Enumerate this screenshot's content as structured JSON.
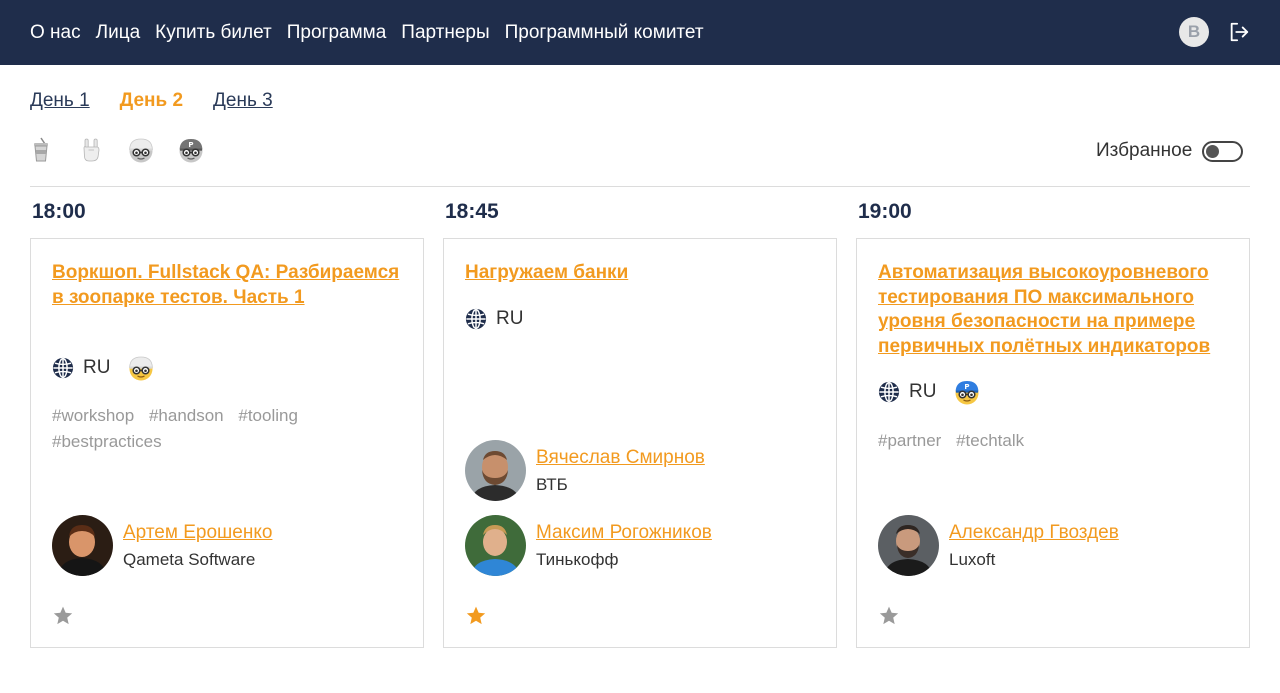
{
  "nav": {
    "items": [
      {
        "label": "О нас"
      },
      {
        "label": "Лица"
      },
      {
        "label": "Купить билет"
      },
      {
        "label": "Программа"
      },
      {
        "label": "Партнеры"
      },
      {
        "label": "Программный комитет"
      }
    ],
    "user_initial": "B"
  },
  "days": [
    {
      "label": "День 1",
      "active": false
    },
    {
      "label": "День 2",
      "active": true
    },
    {
      "label": "День 3",
      "active": false
    }
  ],
  "filters": [
    "cup-icon",
    "rock-hand-icon",
    "nerd-helmet-icon",
    "nerd-partner-icon"
  ],
  "favorites": {
    "label": "Избранное",
    "enabled": false
  },
  "colors": {
    "accent": "#f29a1f",
    "navbar": "#1f2d4b",
    "tag": "#999999"
  },
  "talks": [
    {
      "time": "18:00",
      "title": "Воркшоп. Fullstack QA: Разбираемся в зоопарке тестов. Часть 1",
      "lang": "RU",
      "level_icon": "nerd-helmet-icon",
      "tags": [
        "#workshop",
        "#handson",
        "#tooling",
        "#bestpractices"
      ],
      "speakers": [
        {
          "name": "Артем Ерошенко",
          "company": "Qameta Software"
        }
      ],
      "favorite": false
    },
    {
      "time": "18:45",
      "title": "Нагружаем банки",
      "lang": "RU",
      "level_icon": "",
      "tags": [],
      "speakers": [
        {
          "name": "Вячеслав Смирнов",
          "company": "ВТБ"
        },
        {
          "name": "Максим Рогожников",
          "company": "Тинькофф"
        }
      ],
      "favorite": true
    },
    {
      "time": "19:00",
      "title": "Автоматизация высокоуровневого тестирования ПО максимального уровня безопасности на примере первичных полётных индикаторов",
      "lang": "RU",
      "level_icon": "nerd-partner-icon",
      "tags": [
        "#partner",
        "#techtalk"
      ],
      "speakers": [
        {
          "name": "Александр Гвоздев",
          "company": "Luxoft"
        }
      ],
      "favorite": false
    }
  ]
}
